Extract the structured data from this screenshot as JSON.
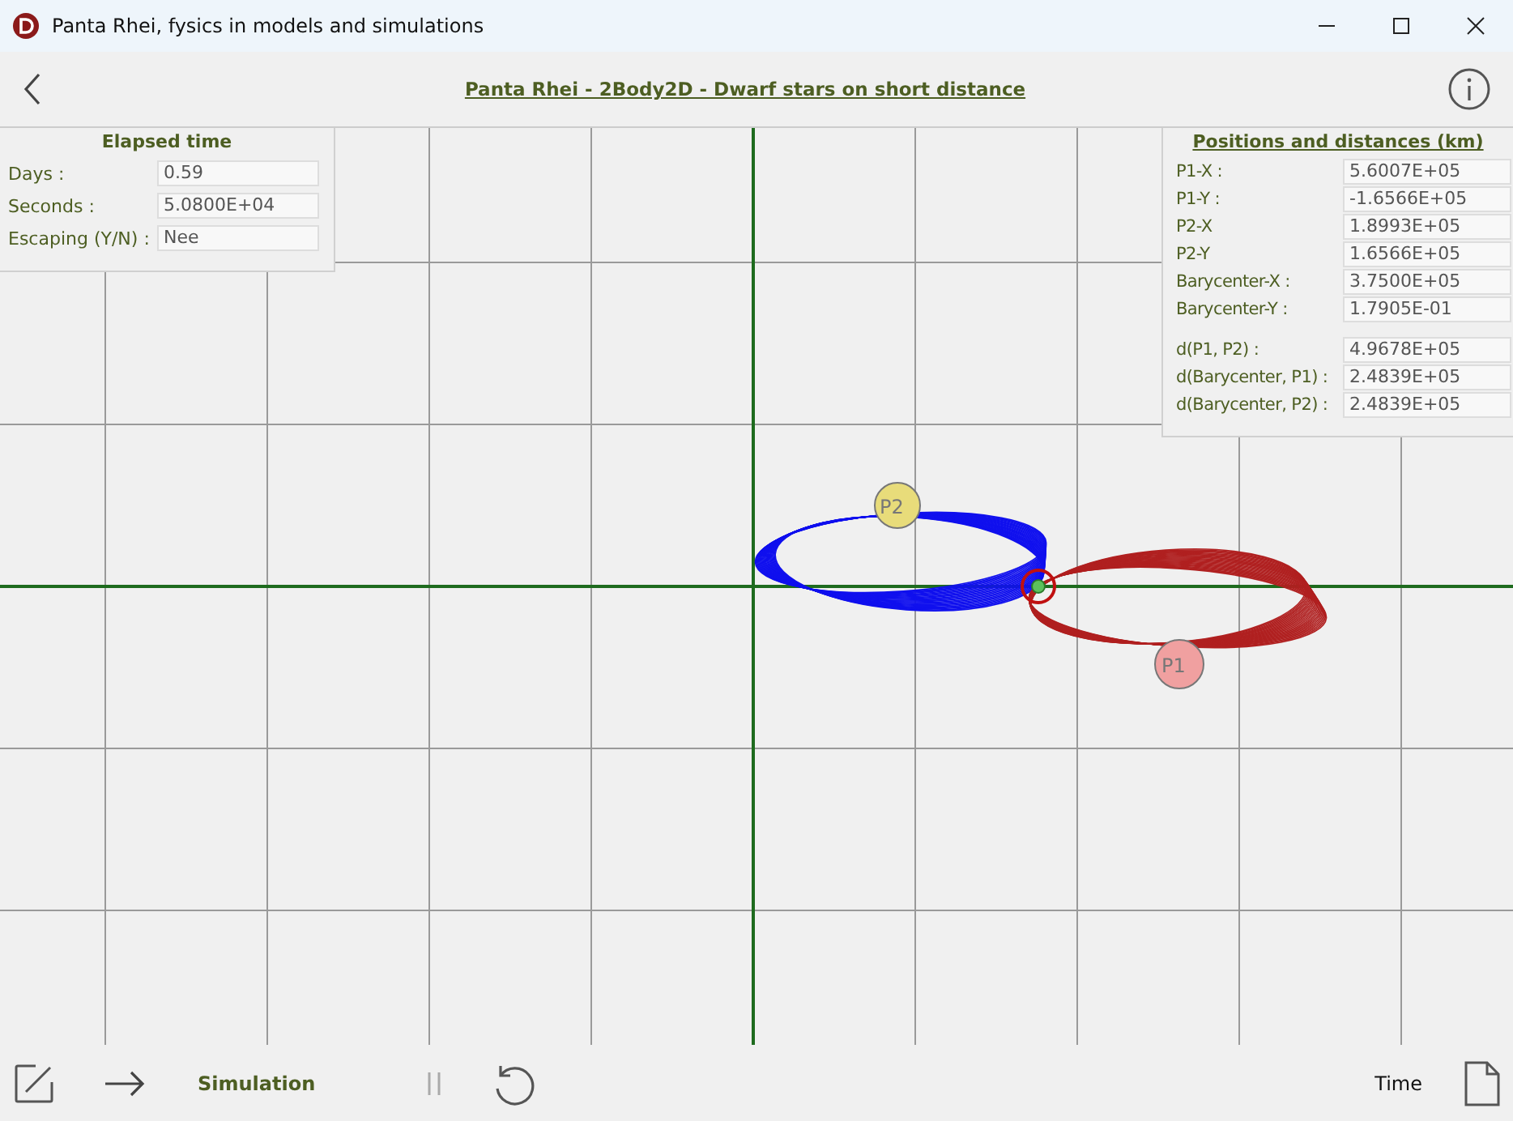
{
  "window": {
    "title": "Panta Rhei, fysics in models and simulations"
  },
  "header": {
    "title": "Panta Rhei - 2Body2D - Dwarf stars on short distance"
  },
  "elapsed": {
    "title": "Elapsed time",
    "rows": [
      {
        "label": "Days :",
        "value": "0.59"
      },
      {
        "label": "Seconds :",
        "value": "5.0800E+04"
      },
      {
        "label": "Escaping (Y/N) :",
        "value": "Nee"
      }
    ]
  },
  "positions": {
    "title": "Positions and distances (km)",
    "groups": [
      [
        {
          "label": "P1-X :",
          "value": "5.6007E+05"
        },
        {
          "label": "P1-Y :",
          "value": "-1.6566E+05"
        },
        {
          "label": "P2-X",
          "value": "1.8993E+05"
        },
        {
          "label": "P2-Y",
          "value": "1.6566E+05"
        },
        {
          "label": "Barycenter-X :",
          "value": "3.7500E+05"
        },
        {
          "label": "Barycenter-Y :",
          "value": "1.7905E-01"
        }
      ],
      [
        {
          "label": "d(P1, P2) :",
          "value": "4.9678E+05"
        },
        {
          "label": "d(Barycenter, P1) :",
          "value": "2.4839E+05"
        },
        {
          "label": "d(Barycenter, P2) :",
          "value": "2.4839E+05"
        }
      ]
    ]
  },
  "bodies": [
    {
      "label": "P2",
      "color": "#e8dc7a"
    },
    {
      "label": "P1",
      "color": "#f0a0a0"
    }
  ],
  "toolbar": {
    "mode": "Simulation",
    "time_label": "Time"
  }
}
